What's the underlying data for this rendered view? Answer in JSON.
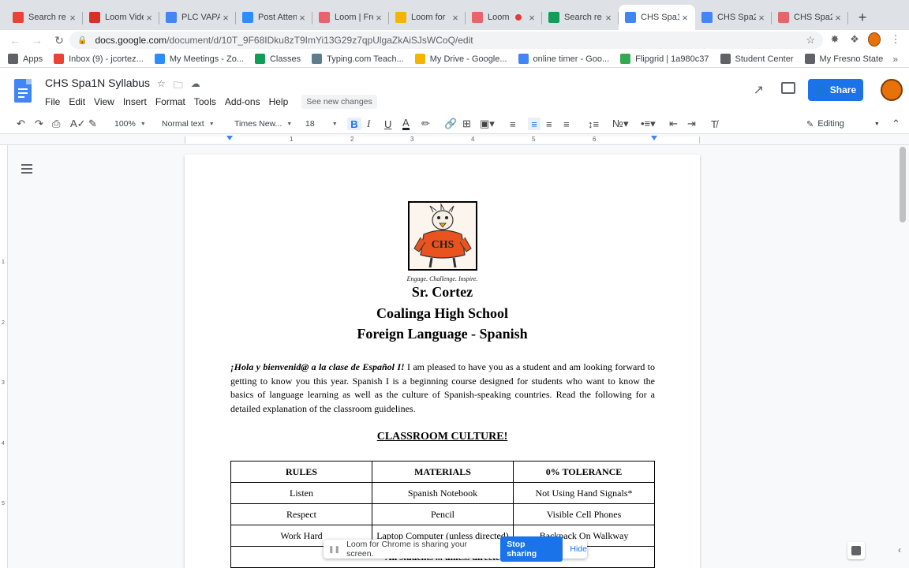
{
  "browser": {
    "tabs": [
      {
        "title": "Search re",
        "favicon": "gmail-icon",
        "color": "#ea4335",
        "active": false
      },
      {
        "title": "Loom Vide",
        "favicon": "clapper-icon",
        "color": "#d93025",
        "active": false
      },
      {
        "title": "PLC VAPA",
        "favicon": "docs-icon",
        "color": "#4285f4",
        "active": false
      },
      {
        "title": "Post Atten",
        "favicon": "zoom-icon",
        "color": "#2d8cff",
        "active": false
      },
      {
        "title": "Loom | Fre",
        "favicon": "loom-icon",
        "color": "#e8636b",
        "active": false
      },
      {
        "title": "Loom for",
        "favicon": "drive-icon",
        "color": "#f4b400",
        "active": false
      },
      {
        "title": "Loom",
        "favicon": "loom-icon",
        "color": "#e8636b",
        "active": false,
        "recording": true
      },
      {
        "title": "Search re",
        "favicon": "drive-icon",
        "color": "#0f9d58",
        "active": false
      },
      {
        "title": "CHS Spa1",
        "favicon": "docs-icon",
        "color": "#4285f4",
        "active": true
      },
      {
        "title": "CHS Spa2",
        "favicon": "docs-icon",
        "color": "#4285f4",
        "active": false
      },
      {
        "title": "CHS Spa2",
        "favicon": "loom-icon",
        "color": "#e8636b",
        "active": false
      }
    ],
    "new_tab_label": "+",
    "url_host": "docs.google.com",
    "url_path": "/document/d/10T_9F68IDku8zT9ImYi13G29z7qpUlgaZkAiSJsWCoQ/edit",
    "bookmarks": [
      {
        "label": "Apps",
        "icon": "apps-grid-icon",
        "color": "#5f6368"
      },
      {
        "label": "Inbox (9) - jcortez...",
        "icon": "gmail-icon",
        "color": "#ea4335"
      },
      {
        "label": "My Meetings - Zo...",
        "icon": "zoom-icon",
        "color": "#2d8cff"
      },
      {
        "label": "Classes",
        "icon": "classroom-icon",
        "color": "#0f9d58"
      },
      {
        "label": "Typing.com Teach...",
        "icon": "typing-icon",
        "color": "#607d8b"
      },
      {
        "label": "My Drive - Google...",
        "icon": "drive-icon",
        "color": "#f4b400"
      },
      {
        "label": "online timer - Goo...",
        "icon": "google-icon",
        "color": "#4285f4"
      },
      {
        "label": "Flipgrid | 1a980c37",
        "icon": "flipgrid-icon",
        "color": "#34a853"
      },
      {
        "label": "Student Center",
        "icon": "globe-icon",
        "color": "#5f6368"
      },
      {
        "label": "My Fresno State",
        "icon": "globe-icon",
        "color": "#5f6368"
      }
    ]
  },
  "docs": {
    "title": "CHS Spa1N Syllabus",
    "menu": [
      "File",
      "Edit",
      "View",
      "Insert",
      "Format",
      "Tools",
      "Add-ons",
      "Help"
    ],
    "see_changes": "See new changes",
    "share_label": "Share",
    "toolbar": {
      "zoom": "100%",
      "style": "Normal text",
      "font": "Times New...",
      "size": "18",
      "mode": "Editing"
    },
    "ruler_numbers": [
      "1",
      "2",
      "3",
      "4",
      "5",
      "6"
    ],
    "vruler_numbers": [
      "1",
      "2",
      "3",
      "4",
      "5"
    ]
  },
  "document": {
    "tagline": "Engage. Challenge. Inspire.",
    "headings": [
      "Sr. Cortez",
      "Coalinga High School",
      "Foreign Language - Spanish"
    ],
    "intro_lead": "¡Hola y bienvenid@ a la clase de Español I!",
    "intro_body": "  I am pleased to have you as a student and am looking forward to getting to know you this year.  Spanish I is a beginning course designed for students who want to know the basics of language learning as well as the culture of Spanish-speaking countries. Read the following for a detailed explanation of the classroom guidelines.",
    "section_title": "CLASSROOM CULTURE!",
    "table": {
      "headers": [
        "RULES",
        "MATERIALS",
        "0% TOLERANCE"
      ],
      "rows": [
        [
          "Listen",
          "Spanish Notebook",
          "Not Using Hand Signals*"
        ],
        [
          "Respect",
          "Pencil",
          "Visible Cell Phones"
        ],
        [
          "Work Hard",
          "Laptop Computer (unless directed)",
          "Backpack On Walkway"
        ]
      ],
      "note": "*All students ... unless directed"
    }
  },
  "loom_bar": {
    "message": "Loom for Chrome is sharing your screen.",
    "stop_label": "Stop sharing",
    "hide_label": "Hide"
  },
  "colors": {
    "accent": "#1a73e8",
    "mascot_orange": "#e8531f"
  }
}
